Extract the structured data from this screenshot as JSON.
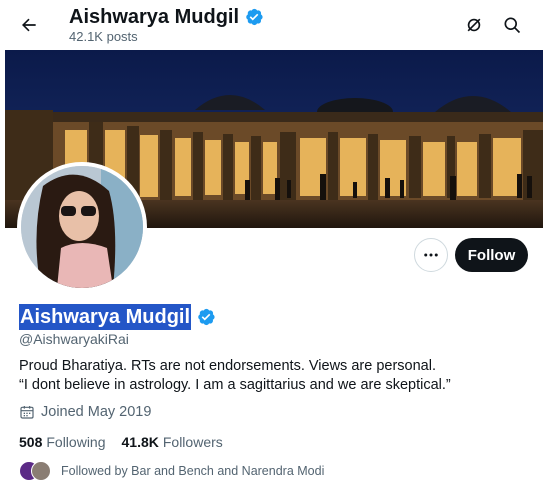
{
  "header": {
    "name": "Aishwarya Mudgil",
    "post_count": "42.1K posts"
  },
  "actions": {
    "follow_label": "Follow"
  },
  "profile": {
    "display_name": "Aishwarya Mudgil",
    "handle": "@AishwaryakiRai",
    "bio_line_1": "Proud Bharatiya. RTs are not endorsements. Views are personal.",
    "bio_line_2": "“I dont believe in astrology. I am a sagittarius and we are skeptical.”",
    "joined": "Joined May 2019",
    "following_count": "508",
    "following_label": "Following",
    "followers_count": "41.8K",
    "followers_label": "Followers",
    "followed_by": "Followed by Bar and Bench and Narendra Modi"
  },
  "colors": {
    "verified": "#1d9bf0",
    "follow_bg": "#0f1419",
    "name_highlight": "#2456c7"
  },
  "icons": {
    "back": "arrow-left-icon",
    "grok": "grok-icon",
    "search": "search-icon",
    "more": "more-dots-icon",
    "verified": "verified-badge-icon",
    "calendar": "calendar-icon"
  }
}
